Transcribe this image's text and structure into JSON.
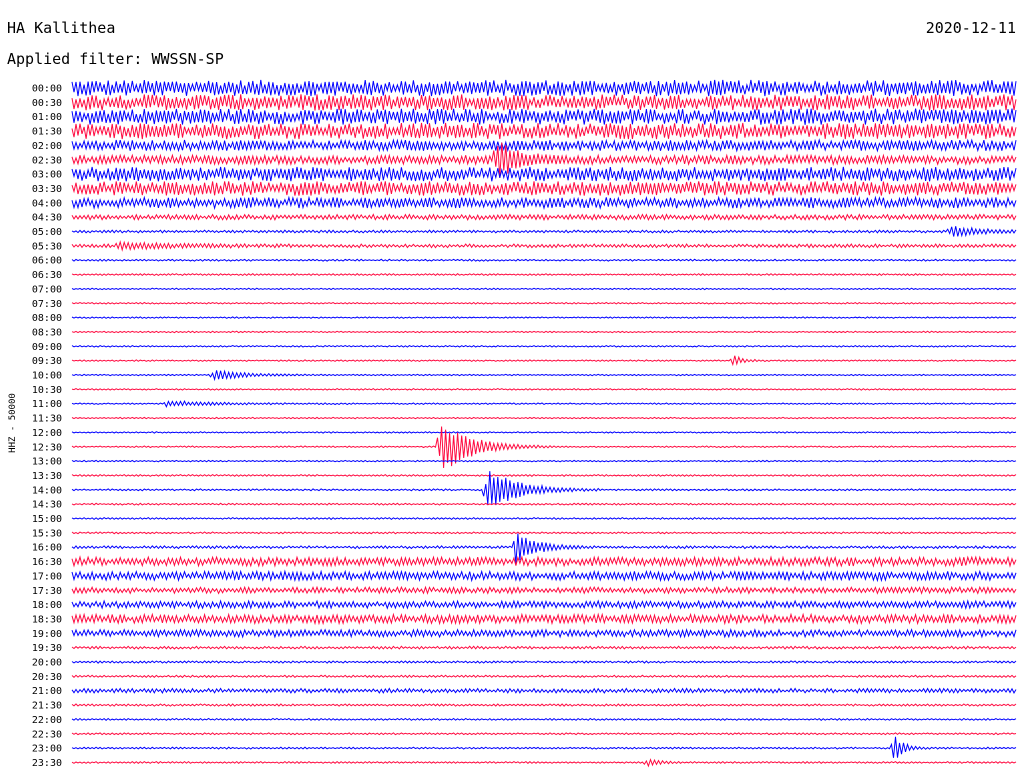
{
  "header": {
    "station": "HA Kallithea",
    "date": "2020-12-11",
    "filter": "Applied filter: WWSSN-SP"
  },
  "colors": {
    "a": "#0000ff",
    "b": "#ff0a40",
    "text": "#000000"
  },
  "chart_data": {
    "type": "line",
    "ylabel": "HHZ - 50000",
    "trace_interval_minutes": 30,
    "rows": [
      "00:00",
      "00:30",
      "01:00",
      "01:30",
      "02:00",
      "02:30",
      "03:00",
      "03:30",
      "04:00",
      "04:30",
      "05:00",
      "05:30",
      "06:00",
      "06:30",
      "07:00",
      "07:30",
      "08:00",
      "08:30",
      "09:00",
      "09:30",
      "10:00",
      "10:30",
      "11:00",
      "11:30",
      "12:00",
      "12:30",
      "13:00",
      "13:30",
      "14:00",
      "14:30",
      "15:00",
      "15:30",
      "16:00",
      "16:30",
      "17:00",
      "17:30",
      "18:00",
      "18:30",
      "19:00",
      "19:30",
      "20:00",
      "20:30",
      "21:00",
      "21:30",
      "22:00",
      "22:30",
      "23:00",
      "23:30"
    ],
    "noise": [
      0.9,
      0.9,
      0.9,
      0.9,
      0.6,
      0.5,
      0.8,
      0.8,
      0.6,
      0.3,
      0.15,
      0.2,
      0.1,
      0.1,
      0.08,
      0.08,
      0.08,
      0.08,
      0.08,
      0.08,
      0.08,
      0.08,
      0.08,
      0.08,
      0.08,
      0.08,
      0.08,
      0.1,
      0.1,
      0.1,
      0.1,
      0.1,
      0.15,
      0.5,
      0.5,
      0.35,
      0.4,
      0.5,
      0.4,
      0.15,
      0.12,
      0.12,
      0.25,
      0.12,
      0.1,
      0.1,
      0.1,
      0.1
    ],
    "events": [
      {
        "row": 25,
        "t": 0.39,
        "amp": 3.2,
        "dur": 0.03
      },
      {
        "row": 28,
        "t": 0.44,
        "amp": 2.5,
        "dur": 0.03
      },
      {
        "row": 32,
        "t": 0.47,
        "amp": 2.0,
        "dur": 0.02
      },
      {
        "row": 19,
        "t": 0.7,
        "amp": 0.6,
        "dur": 0.01
      },
      {
        "row": 20,
        "t": 0.15,
        "amp": 0.6,
        "dur": 0.03
      },
      {
        "row": 22,
        "t": 0.1,
        "amp": 0.3,
        "dur": 0.05
      },
      {
        "row": 46,
        "t": 0.87,
        "amp": 1.6,
        "dur": 0.01
      },
      {
        "row": 47,
        "t": 0.61,
        "amp": 0.5,
        "dur": 0.01
      },
      {
        "row": 5,
        "t": 0.45,
        "amp": 2.0,
        "dur": 0.02
      },
      {
        "row": 11,
        "t": 0.05,
        "amp": 0.4,
        "dur": 0.05
      },
      {
        "row": 10,
        "t": 0.93,
        "amp": 0.6,
        "dur": 0.03
      }
    ]
  }
}
